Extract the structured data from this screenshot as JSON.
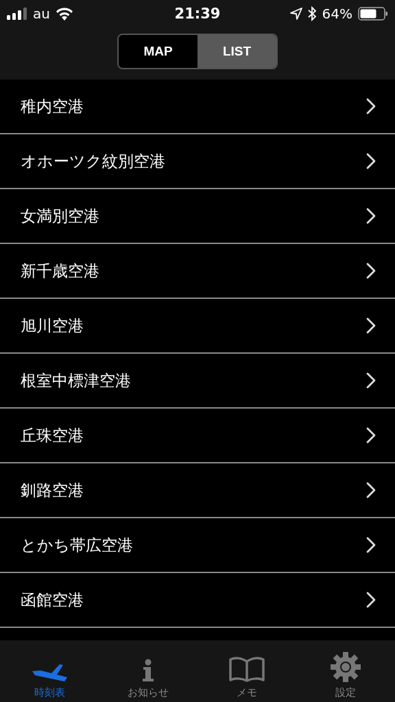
{
  "status_bar": {
    "carrier": "au",
    "time": "21:39",
    "battery": "64%"
  },
  "segments": [
    {
      "label": "MAP",
      "selected": false
    },
    {
      "label": "LIST",
      "selected": true
    }
  ],
  "airports": [
    "稚内空港",
    "オホーツク紋別空港",
    "女満別空港",
    "新千歳空港",
    "旭川空港",
    "根室中標津空港",
    "丘珠空港",
    "釧路空港",
    "とかち帯広空港",
    "函館空港"
  ],
  "tab_bar": [
    {
      "label": "時刻表",
      "selected": true
    },
    {
      "label": "お知らせ",
      "selected": false
    },
    {
      "label": "メモ",
      "selected": false
    },
    {
      "label": "設定",
      "selected": false
    }
  ]
}
